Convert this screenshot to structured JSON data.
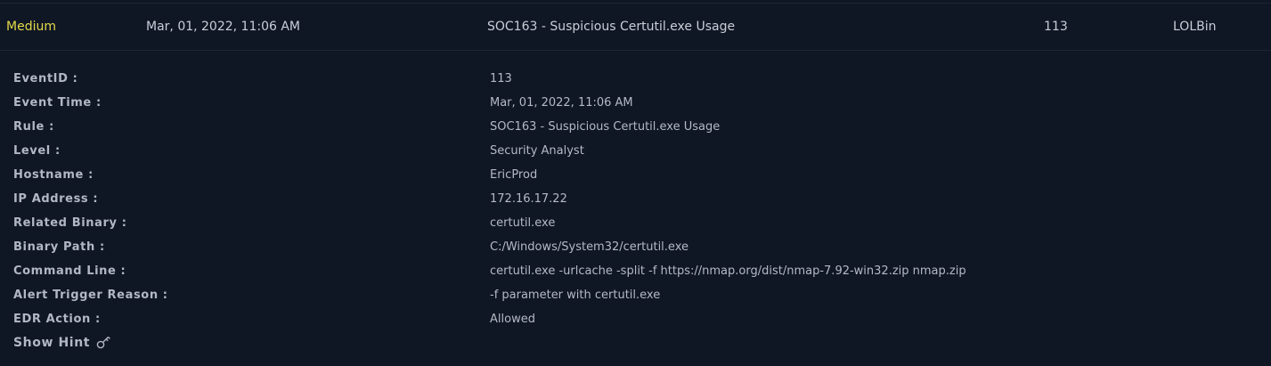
{
  "alert": {
    "level": "Medium",
    "date": "Mar, 01, 2022, 11:06 AM",
    "rule": "SOC163 - Suspicious Certutil.exe Usage",
    "event_id": "113",
    "type": "LOLBin"
  },
  "details": [
    {
      "label": "EventID :",
      "value": "113"
    },
    {
      "label": "Event Time :",
      "value": "Mar, 01, 2022, 11:06 AM"
    },
    {
      "label": "Rule :",
      "value": "SOC163 - Suspicious Certutil.exe Usage"
    },
    {
      "label": "Level :",
      "value": "Security Analyst"
    },
    {
      "label": "Hostname :",
      "value": "EricProd"
    },
    {
      "label": "IP Address :",
      "value": "172.16.17.22"
    },
    {
      "label": "Related Binary :",
      "value": "certutil.exe"
    },
    {
      "label": "Binary Path :",
      "value": "C:/Windows/System32/certutil.exe"
    },
    {
      "label": "Command Line :",
      "value": "certutil.exe -urlcache -split -f https://nmap.org/dist/nmap-7.92-win32.zip nmap.zip"
    },
    {
      "label": "Alert Trigger Reason :",
      "value": "-f parameter with certutil.exe"
    },
    {
      "label": "EDR Action :",
      "value": "Allowed"
    }
  ],
  "hint": {
    "label": "Show Hint",
    "icon": "key-icon"
  },
  "colors": {
    "background": "#0f1624",
    "level_medium": "#e3d94a",
    "text": "#c9ced6"
  }
}
